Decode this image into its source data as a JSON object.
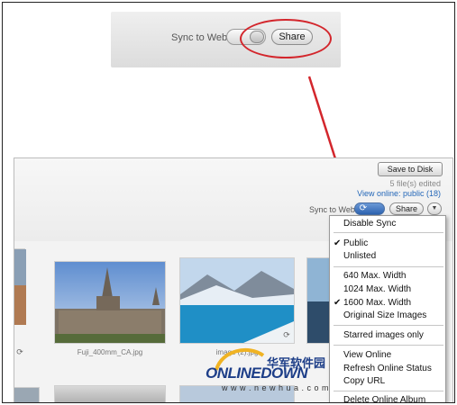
{
  "top_strip": {
    "sync_label": "Sync to Web",
    "share_label": "Share"
  },
  "header": {
    "save_label": "Save to Disk",
    "edited_text": "5 file(s) edited",
    "view_online_text": "View online: public (18)",
    "sync_label": "Sync to Web",
    "share_label": "Share"
  },
  "thumbnails": [
    {
      "label": ""
    },
    {
      "label": "Fuji_400mm_CA.jpg"
    },
    {
      "label": "image (2).jpg"
    },
    {
      "label": ""
    }
  ],
  "menu": {
    "items": [
      {
        "label": "Disable Sync",
        "checked": false
      },
      {
        "label": "Public",
        "checked": true
      },
      {
        "label": "Unlisted",
        "checked": false
      },
      {
        "label": "640 Max. Width",
        "checked": false
      },
      {
        "label": "1024 Max. Width",
        "checked": false
      },
      {
        "label": "1600 Max. Width",
        "checked": true
      },
      {
        "label": "Original Size Images",
        "checked": false
      },
      {
        "label": "Starred images only",
        "checked": false
      },
      {
        "label": "View Online",
        "checked": false
      },
      {
        "label": "Refresh Online Status",
        "checked": false
      },
      {
        "label": "Copy URL",
        "checked": false
      },
      {
        "label": "Delete Online Album",
        "checked": false
      }
    ]
  },
  "watermark": {
    "chinese": "华军软件园",
    "logo": "ONLINEDOWN",
    "url": "w w w . n e w h u a . c o m"
  },
  "colors": {
    "highlight": "#d3262c",
    "link": "#2467b8",
    "brand": "#1d3e88"
  }
}
